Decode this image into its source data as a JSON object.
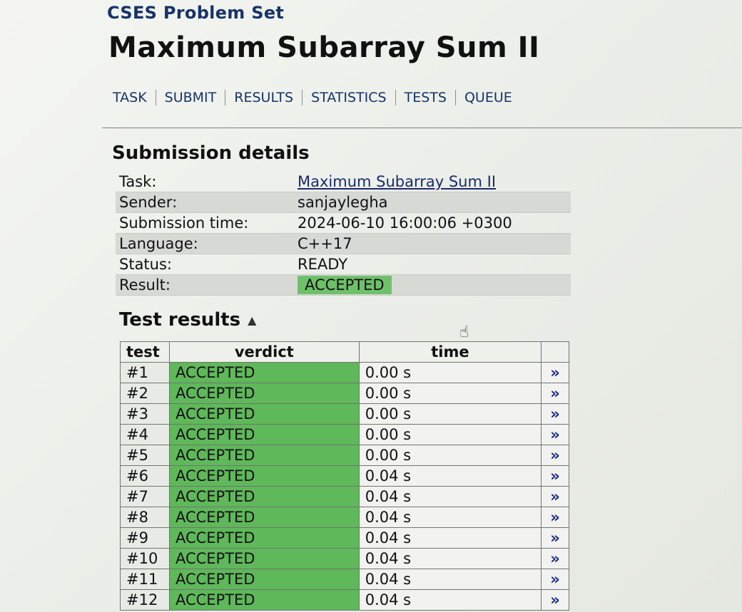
{
  "site_title": "CSES Problem Set",
  "page_title": "Maximum Subarray Sum II",
  "nav": [
    "TASK",
    "SUBMIT",
    "RESULTS",
    "STATISTICS",
    "TESTS",
    "QUEUE"
  ],
  "submission": {
    "heading": "Submission details",
    "rows": [
      {
        "label": "Task:",
        "value": "Maximum Subarray Sum II"
      },
      {
        "label": "Sender:",
        "value": "sanjaylegha"
      },
      {
        "label": "Submission time:",
        "value": "2024-06-10 16:00:06 +0300"
      },
      {
        "label": "Language:",
        "value": "C++17"
      },
      {
        "label": "Status:",
        "value": "READY"
      },
      {
        "label": "Result:",
        "value": "ACCEPTED"
      }
    ]
  },
  "tests": {
    "heading": "Test results",
    "sort_icon": "triangle-up-icon",
    "headers": {
      "test": "test",
      "verdict": "verdict",
      "time": "time"
    },
    "rows": [
      {
        "num": "#1",
        "verdict": "ACCEPTED",
        "time": "0.00 s"
      },
      {
        "num": "#2",
        "verdict": "ACCEPTED",
        "time": "0.00 s"
      },
      {
        "num": "#3",
        "verdict": "ACCEPTED",
        "time": "0.00 s"
      },
      {
        "num": "#4",
        "verdict": "ACCEPTED",
        "time": "0.00 s"
      },
      {
        "num": "#5",
        "verdict": "ACCEPTED",
        "time": "0.00 s"
      },
      {
        "num": "#6",
        "verdict": "ACCEPTED",
        "time": "0.04 s"
      },
      {
        "num": "#7",
        "verdict": "ACCEPTED",
        "time": "0.04 s"
      },
      {
        "num": "#8",
        "verdict": "ACCEPTED",
        "time": "0.04 s"
      },
      {
        "num": "#9",
        "verdict": "ACCEPTED",
        "time": "0.04 s"
      },
      {
        "num": "#10",
        "verdict": "ACCEPTED",
        "time": "0.04 s"
      },
      {
        "num": "#11",
        "verdict": "ACCEPTED",
        "time": "0.04 s"
      },
      {
        "num": "#12",
        "verdict": "ACCEPTED",
        "time": "0.04 s"
      }
    ],
    "link_glyph": "»"
  },
  "colors": {
    "accent": "#173368",
    "accepted": "#5fb85a",
    "link": "#1c2d8f"
  }
}
